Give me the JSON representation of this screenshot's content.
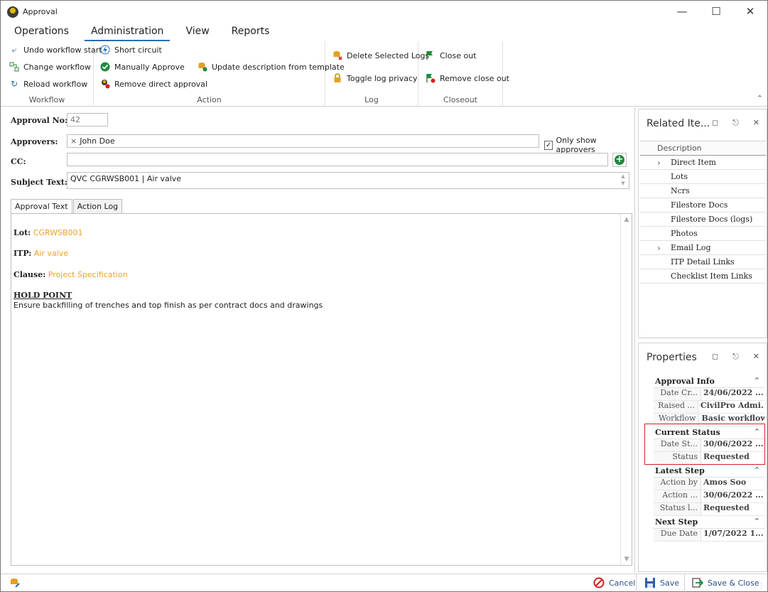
{
  "window": {
    "title": "Approval"
  },
  "menu": {
    "tabs": [
      "Operations",
      "Administration",
      "View",
      "Reports"
    ]
  },
  "ribbon": {
    "workflow": {
      "title": "Workflow",
      "undo": "Undo workflow start",
      "change": "Change workflow",
      "reload": "Reload workflow"
    },
    "action": {
      "title": "Action",
      "short_circuit": "Short circuit",
      "manually_approve": "Manually Approve",
      "remove_direct": "Remove direct approval",
      "update_desc": "Update description from template"
    },
    "log": {
      "title": "Log",
      "delete_logs": "Delete Selected Logs",
      "toggle_privacy": "Toggle log privacy"
    },
    "closeout": {
      "title": "Closeout",
      "close_out": "Close out",
      "remove_close_out": "Remove close out"
    }
  },
  "form": {
    "approval_no_label": "Approval No:",
    "approval_no_value": "42",
    "approvers_label": "Approvers:",
    "approver_chip": "John  Doe",
    "only_show_approvers": "Only show approvers",
    "cc_label": "CC:",
    "subject_label": "Subject Text:",
    "subject_value": "QVC CGRWSB001 | Air valve"
  },
  "tabs": {
    "approval_text": "Approval Text",
    "action_log": "Action Log"
  },
  "approval_text": {
    "lot_key": "Lot:",
    "lot_value": "CGRWSB001",
    "itp_key": "ITP:",
    "itp_value": "Air valve",
    "clause_key": "Clause:",
    "clause_value": "Project Specification",
    "hold_point": "HOLD POINT",
    "instruction": "Ensure backfilling of trenches and top finish as per contract docs and drawings"
  },
  "related": {
    "title": "Related Ite...",
    "column": "Description",
    "items": [
      "Direct Item",
      "Lots",
      "Ncrs",
      "Filestore Docs",
      "Filestore Docs (logs)",
      "Photos",
      "Email Log",
      "ITP Detail Links",
      "Checklist Item Links"
    ]
  },
  "properties": {
    "title": "Properties",
    "approval_info": {
      "label": "Approval Info",
      "date_cr_name": "Date Cr...",
      "date_cr_value": "24/06/2022 ...",
      "raised_name": "Raised ...",
      "raised_value": "CivilPro Admi...",
      "workflow_name": "Workflow",
      "workflow_value": "Basic workflow"
    },
    "current_status": {
      "label": "Current Status",
      "date_st_name": "Date St...",
      "date_st_value": "30/06/2022 ...",
      "status_name": "Status",
      "status_value": "Requested"
    },
    "latest_step": {
      "label": "Latest Step",
      "action_by_name": "Action by",
      "action_by_value": "Amos Soo",
      "action_name": "Action ...",
      "action_value": "30/06/2022 ...",
      "status_l_name": "Status l...",
      "status_l_value": "Requested"
    },
    "next_step": {
      "label": "Next Step",
      "due_date_name": "Due Date",
      "due_date_value": "1/07/2022 1..."
    }
  },
  "statusbar": {
    "cancel": "Cancel",
    "save": "Save",
    "save_close": "Save & Close"
  }
}
